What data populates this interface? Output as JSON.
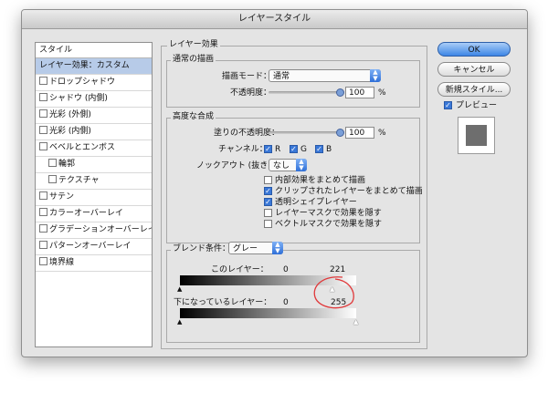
{
  "window": {
    "title": "レイヤースタイル"
  },
  "style_list": {
    "header": "スタイル",
    "items": [
      {
        "label": "レイヤー効果：カスタム",
        "checkbox": false,
        "selected": true,
        "indent": false
      },
      {
        "label": "ドロップシャドウ",
        "checkbox": true,
        "selected": false,
        "indent": false
      },
      {
        "label": "シャドウ (内側)",
        "checkbox": true,
        "selected": false,
        "indent": false
      },
      {
        "label": "光彩 (外側)",
        "checkbox": true,
        "selected": false,
        "indent": false
      },
      {
        "label": "光彩 (内側)",
        "checkbox": true,
        "selected": false,
        "indent": false
      },
      {
        "label": "ベベルとエンボス",
        "checkbox": true,
        "selected": false,
        "indent": false
      },
      {
        "label": "輪郭",
        "checkbox": true,
        "selected": false,
        "indent": true
      },
      {
        "label": "テクスチャ",
        "checkbox": true,
        "selected": false,
        "indent": true
      },
      {
        "label": "サテン",
        "checkbox": true,
        "selected": false,
        "indent": false
      },
      {
        "label": "カラーオーバーレイ",
        "checkbox": true,
        "selected": false,
        "indent": false
      },
      {
        "label": "グラデーションオーバーレイ",
        "checkbox": true,
        "selected": false,
        "indent": false
      },
      {
        "label": "パターンオーバーレイ",
        "checkbox": true,
        "selected": false,
        "indent": false
      },
      {
        "label": "境界線",
        "checkbox": true,
        "selected": false,
        "indent": false
      }
    ]
  },
  "layer_effects": {
    "title": "レイヤー効果",
    "normal_blend": {
      "title": "通常の描画",
      "blend_mode_label": "描画モード：",
      "blend_mode_value": "通常",
      "opacity_label": "不透明度：",
      "opacity_value": "100",
      "opacity_unit": "%"
    },
    "advanced_blend": {
      "title": "高度な合成",
      "fill_opacity_label": "塗りの不透明度：",
      "fill_opacity_value": "100",
      "fill_opacity_unit": "%",
      "channels_label": "チャンネル：",
      "channels": [
        {
          "label": "R",
          "checked": true
        },
        {
          "label": "G",
          "checked": true
        },
        {
          "label": "B",
          "checked": true
        }
      ],
      "knockout_label": "ノックアウト (抜き)：",
      "knockout_value": "なし",
      "options": [
        {
          "label": "内部効果をまとめて描画",
          "checked": false
        },
        {
          "label": "クリップされたレイヤーをまとめて描画",
          "checked": true
        },
        {
          "label": "透明シェイプレイヤー",
          "checked": true
        },
        {
          "label": "レイヤーマスクで効果を隠す",
          "checked": false
        },
        {
          "label": "ベクトルマスクで効果を隠す",
          "checked": false
        }
      ]
    },
    "blend_if": {
      "label": "ブレンド条件：",
      "value": "グレー",
      "this_layer_label": "このレイヤー：",
      "this_layer_min": "0",
      "this_layer_max": "221",
      "underlying_label": "下になっているレイヤー：",
      "underlying_min": "0",
      "underlying_max": "255"
    }
  },
  "buttons": {
    "ok": "OK",
    "cancel": "キャンセル",
    "new_style": "新規スタイル..."
  },
  "preview": {
    "label": "プレビュー",
    "checked": true
  },
  "colors": {
    "accent": "#3a78d8",
    "selection": "#b7cbe8",
    "annotation_circle": "#e0383a"
  }
}
